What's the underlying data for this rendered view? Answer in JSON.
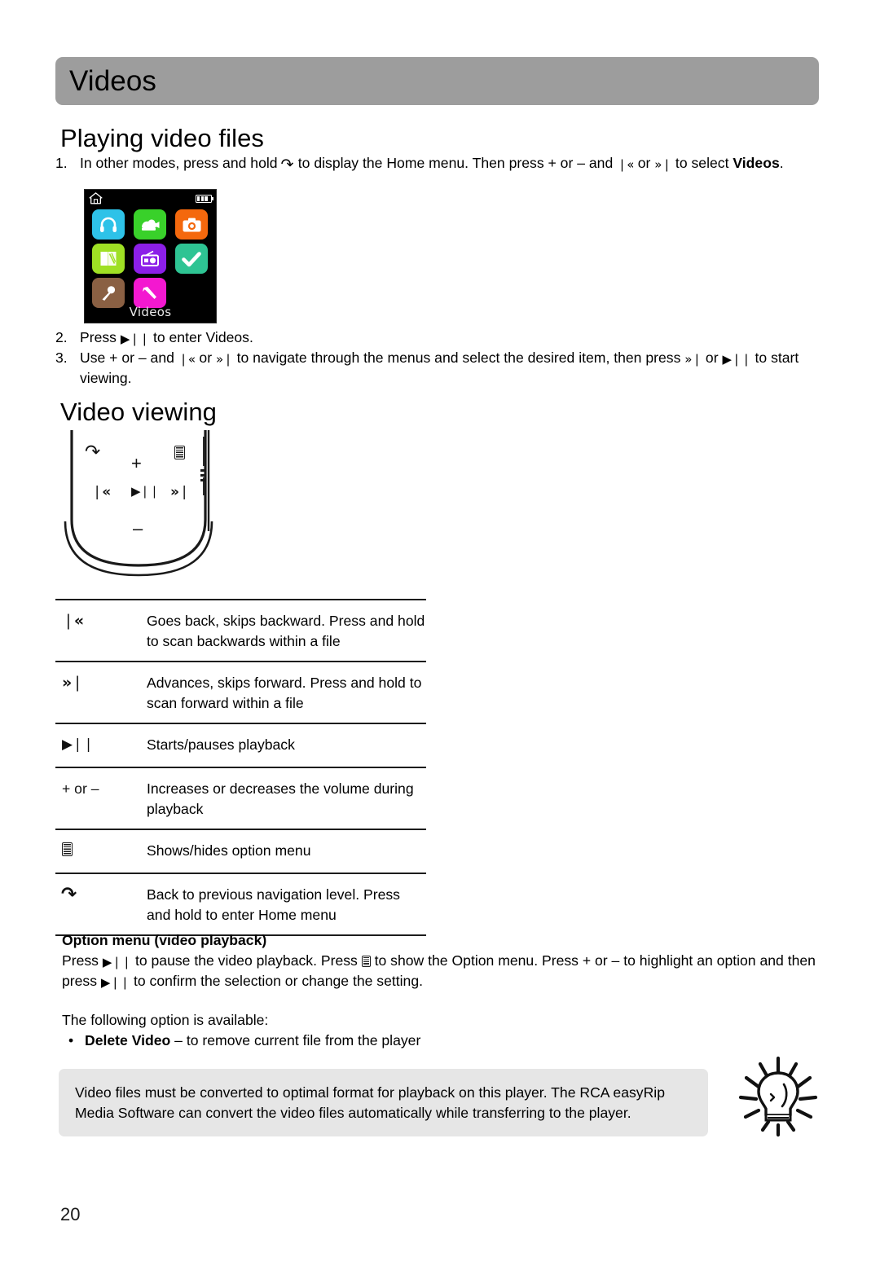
{
  "header": {
    "title": "Videos"
  },
  "sections": {
    "playing_title": "Playing video files",
    "viewing_title": "Video viewing"
  },
  "steps": [
    {
      "num": "1.",
      "pre": "In other modes, press and hold ",
      "icon1": "back-icon",
      "mid1": " to display the Home menu. Then press + or – and ",
      "icon2": "skip-backward-icon",
      "mid2": " or ",
      "icon3": "skip-forward-icon",
      "post": " to select ",
      "bold": "Videos",
      "tail": "."
    },
    {
      "num": "2.",
      "pre": "Press ",
      "icon1": "play-pause-icon",
      "post": " to enter Videos."
    },
    {
      "num": "3.",
      "pre": "Use + or – and ",
      "icon1": "skip-backward-icon",
      "mid1": " or ",
      "icon2": "skip-forward-icon",
      "mid2": " to navigate through the menus and select the desired item, then press ",
      "icon3": "skip-forward-icon",
      "mid3": " or ",
      "icon4": "play-pause-icon",
      "post": " to start viewing."
    }
  ],
  "device_screen": {
    "status_home_icon": "home-icon",
    "status_battery_icon": "battery-icon",
    "selected_label": "Videos",
    "icons": [
      {
        "name": "music-icon",
        "color": "#2ec2e8",
        "glyph": "headphones"
      },
      {
        "name": "video-icon",
        "color": "#39d12a",
        "glyph": "camcorder"
      },
      {
        "name": "photo-icon",
        "color": "#f4680d",
        "glyph": "camera"
      },
      {
        "name": "books-icon",
        "color": "#9fe024",
        "glyph": "book"
      },
      {
        "name": "radio-icon",
        "color": "#8c1fe8",
        "glyph": "radio"
      },
      {
        "name": "tasks-icon",
        "color": "#2ec493",
        "glyph": "check"
      },
      {
        "name": "recorder-icon",
        "color": "#8a6043",
        "glyph": "microphone"
      },
      {
        "name": "settings-icon",
        "color": "#f318d0",
        "glyph": "tool"
      }
    ]
  },
  "player_illustration": {
    "buttons": [
      {
        "name": "back-button",
        "label": "↺"
      },
      {
        "name": "volume-up-button",
        "label": "+"
      },
      {
        "name": "option-menu-button",
        "label": "menu"
      },
      {
        "name": "skip-backward-button",
        "label": "❘«"
      },
      {
        "name": "play-pause-button",
        "label": "▶❘❘"
      },
      {
        "name": "skip-forward-button",
        "label": "»❘"
      },
      {
        "name": "volume-down-button",
        "label": "–"
      }
    ]
  },
  "key_table": {
    "rows": [
      {
        "key_type": "icon",
        "key_icon": "skip-backward-icon",
        "key_label": "❘«",
        "desc": "Goes back, skips backward. Press and hold to scan backwards within a file"
      },
      {
        "key_type": "icon",
        "key_icon": "skip-forward-icon",
        "key_label": "»❘",
        "desc": "Advances, skips forward. Press and hold to scan forward within a file"
      },
      {
        "key_type": "icon",
        "key_icon": "play-pause-icon",
        "key_label": "▶❘❘",
        "desc": "Starts/pauses playback"
      },
      {
        "key_type": "text",
        "key_icon": "volume-keys",
        "key_label": "+ or –",
        "desc": "Increases or decreases the volume during playback"
      },
      {
        "key_type": "menu",
        "key_icon": "option-menu-icon",
        "key_label": "",
        "desc": "Shows/hides option menu"
      },
      {
        "key_type": "back",
        "key_icon": "back-icon",
        "key_label": "↺",
        "desc": "Back to previous navigation level. Press and hold to enter Home menu"
      }
    ]
  },
  "option_menu": {
    "heading": "Option menu (video playback)",
    "para_pre": "Press ",
    "para_icon1": "play-pause-icon",
    "para_mid1": " to pause the video playback. Press ",
    "para_icon2": "option-menu-icon",
    "para_mid2": " to show the Option menu. Press + or – to highlight an option and then press ",
    "para_icon3": "play-pause-icon",
    "para_post": " to confirm the selection or change the setting.",
    "available_line": "The following option is available:",
    "bullet_dot": "•",
    "bullet_bold": "Delete Video",
    "bullet_rest": " – to remove current file from the player"
  },
  "tip": {
    "icon": "lightbulb-icon",
    "text": "Video files must be converted to optimal format for playback on this player. The RCA easyRip Media Software can convert the video files automatically while transferring to the player."
  },
  "footer": {
    "page_number": "20"
  }
}
